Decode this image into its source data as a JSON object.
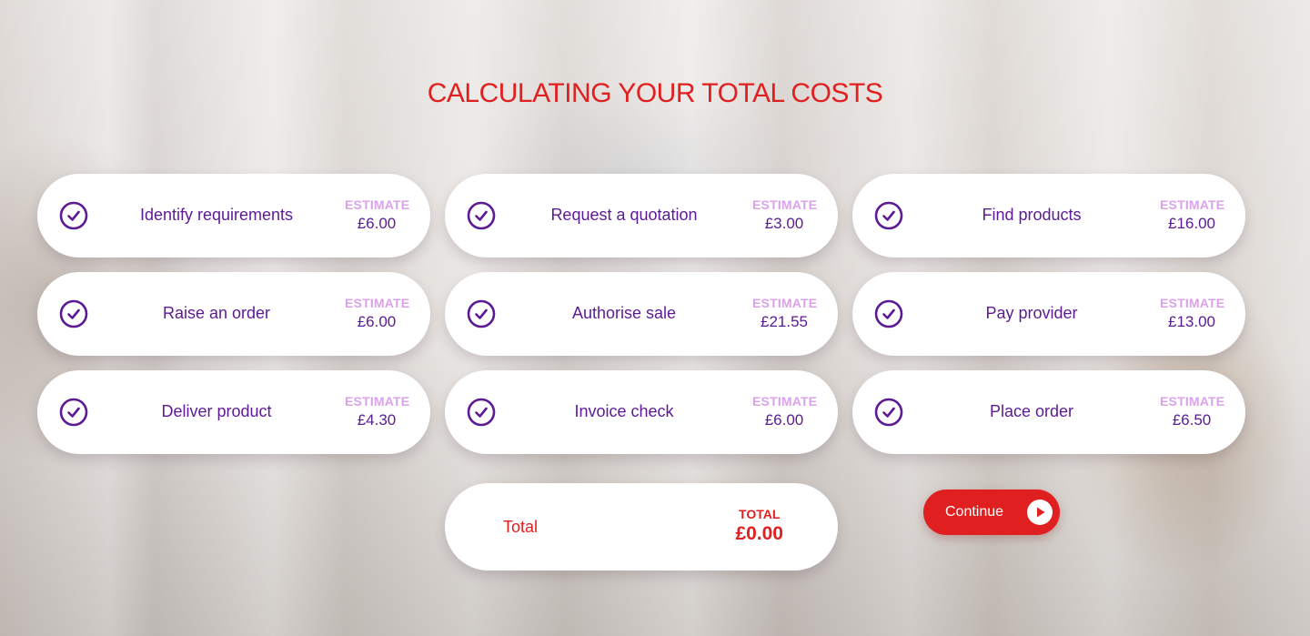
{
  "title": "CALCULATING YOUR TOTAL COSTS",
  "estimate_label": "ESTIMATE",
  "steps": [
    {
      "label": "Identify requirements",
      "estimate": "£6.00",
      "icon": "check-circle-icon"
    },
    {
      "label": "Request a quotation",
      "estimate": "£3.00",
      "icon": "check-circle-icon"
    },
    {
      "label": "Find products",
      "estimate": "£16.00",
      "icon": "check-circle-icon"
    },
    {
      "label": "Raise an order",
      "estimate": "£6.00",
      "icon": "check-circle-icon"
    },
    {
      "label": "Authorise sale",
      "estimate": "£21.55",
      "icon": "check-circle-icon"
    },
    {
      "label": "Pay provider",
      "estimate": "£13.00",
      "icon": "check-circle-icon"
    },
    {
      "label": "Deliver product",
      "estimate": "£4.30",
      "icon": "check-circle-icon"
    },
    {
      "label": "Invoice check",
      "estimate": "£6.00",
      "icon": "check-circle-icon"
    },
    {
      "label": "Place order",
      "estimate": "£6.50",
      "icon": "check-circle-icon"
    }
  ],
  "total": {
    "label": "Total",
    "caption": "TOTAL",
    "value": "£0.00"
  },
  "continue_button": {
    "label": "Continue",
    "icon": "play-circle-icon"
  },
  "colors": {
    "accent_red": "#e02020",
    "purple": "#5c1a95",
    "estimate_pink": "#d8a3e8"
  }
}
